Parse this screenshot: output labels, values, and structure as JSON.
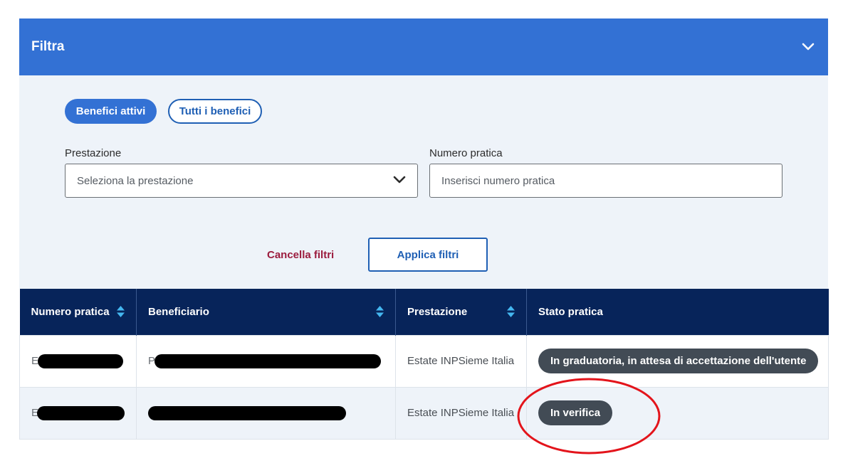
{
  "filter": {
    "title": "Filtra",
    "pills": {
      "active": "Benefici attivi",
      "all": "Tutti i benefici"
    },
    "prestazione": {
      "label": "Prestazione",
      "placeholder": "Seleziona la prestazione"
    },
    "numero": {
      "label": "Numero pratica",
      "placeholder": "Inserisci numero pratica"
    },
    "cancel_label": "Cancella filtri",
    "apply_label": "Applica filtri"
  },
  "table": {
    "headers": [
      "Numero pratica",
      "Beneficiario",
      "Prestazione",
      "Stato pratica"
    ],
    "rows": [
      {
        "numero_visible": "E",
        "beneficiario_visible": "P",
        "prestazione": "Estate INPSieme Italia",
        "stato": "In graduatoria, in attesa di accettazione dell'utente"
      },
      {
        "numero_visible": "E",
        "beneficiario_visible": "",
        "prestazione": "Estate INPSieme Italia",
        "stato": "In verifica"
      }
    ]
  },
  "colors": {
    "header_blue": "#3371d4",
    "table_header_navy": "#07245a",
    "panel_bg": "#eef3f9",
    "badge_gray": "#424b55",
    "cancel_red": "#9b1c3e",
    "annotation_red": "#e3141b"
  },
  "icons": {
    "collapse": "chevron-down-icon",
    "select": "chevron-down-icon",
    "sort": "sort-icon"
  }
}
